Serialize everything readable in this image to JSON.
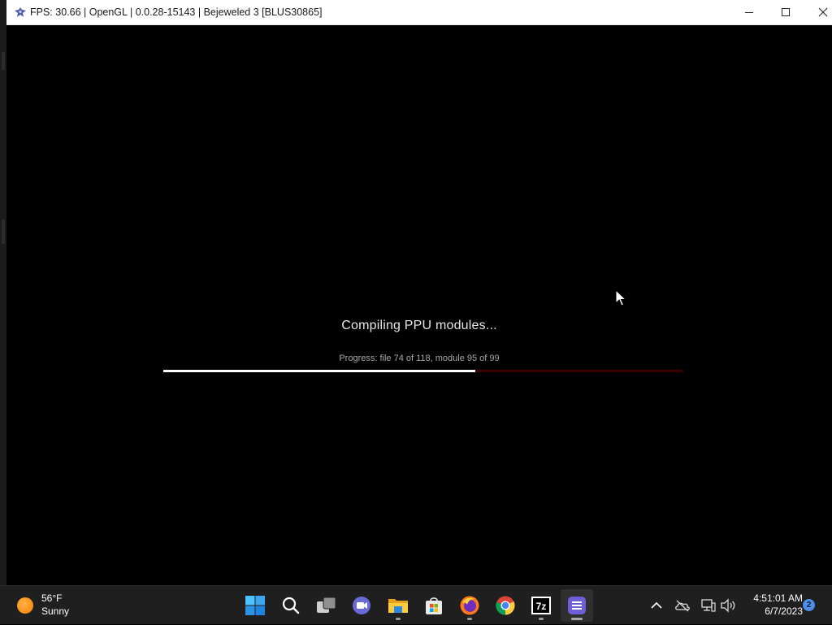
{
  "window": {
    "title": "FPS: 30.66 | OpenGL | 0.0.28-15143 | Bejeweled 3 [BLUS30865]"
  },
  "loading": {
    "heading": "Compiling PPU modules...",
    "progress_text": "Progress: file 74 of 118, module 95 of 99",
    "progress_fraction": 0.6,
    "bar_color": "#ffffff",
    "track_color": "#3a0000"
  },
  "taskbar": {
    "weather": {
      "temperature": "56°F",
      "condition": "Sunny"
    },
    "pinned": [
      {
        "name": "start-button",
        "icon": "windows-logo-icon"
      },
      {
        "name": "search-button",
        "icon": "search-icon"
      },
      {
        "name": "task-view-button",
        "icon": "task-view-icon"
      },
      {
        "name": "chat-button",
        "icon": "video-chat-icon"
      },
      {
        "name": "file-explorer-button",
        "icon": "folder-icon"
      },
      {
        "name": "store-button",
        "icon": "store-bag-icon"
      },
      {
        "name": "firefox-button",
        "icon": "firefox-icon"
      },
      {
        "name": "chrome-button",
        "icon": "chrome-icon"
      },
      {
        "name": "7zip-button",
        "icon": "7zip-icon",
        "label": "7z"
      },
      {
        "name": "rpcs3-button",
        "icon": "rpcs3-icon"
      }
    ],
    "clock": {
      "time": "4:51:01 AM",
      "date": "6/7/2023"
    },
    "notifications": "2"
  }
}
